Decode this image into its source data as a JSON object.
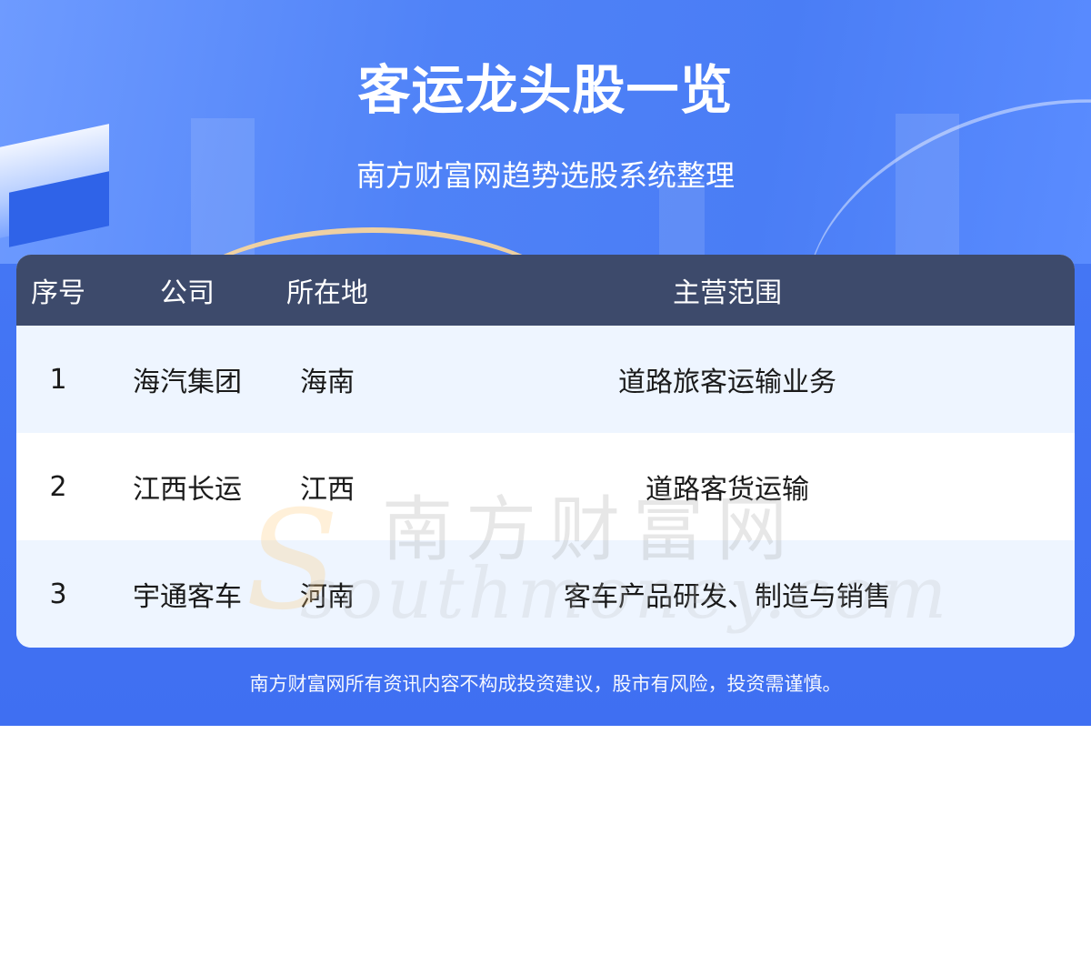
{
  "header": {
    "title": "客运龙头股一览",
    "subtitle": "南方财富网趋势选股系统整理"
  },
  "table": {
    "columns": [
      "序号",
      "公司",
      "所在地",
      "主营范围"
    ],
    "rows": [
      {
        "index": "1",
        "company": "海汽集团",
        "location": "海南",
        "business": "道路旅客运输业务"
      },
      {
        "index": "2",
        "company": "江西长运",
        "location": "江西",
        "business": "道路客货运输"
      },
      {
        "index": "3",
        "company": "宇通客车",
        "location": "河南",
        "business": "客车产品研发、制造与销售"
      }
    ]
  },
  "watermark": {
    "cn": "南方财富网",
    "en": "southmoney.com"
  },
  "footer": {
    "disclaimer": "南方财富网所有资讯内容不构成投资建议，股市有风险，投资需谨慎。"
  },
  "colors": {
    "banner": "#4476f4",
    "header_row": "#3d4a6b",
    "alt_row": "#eef5ff"
  }
}
